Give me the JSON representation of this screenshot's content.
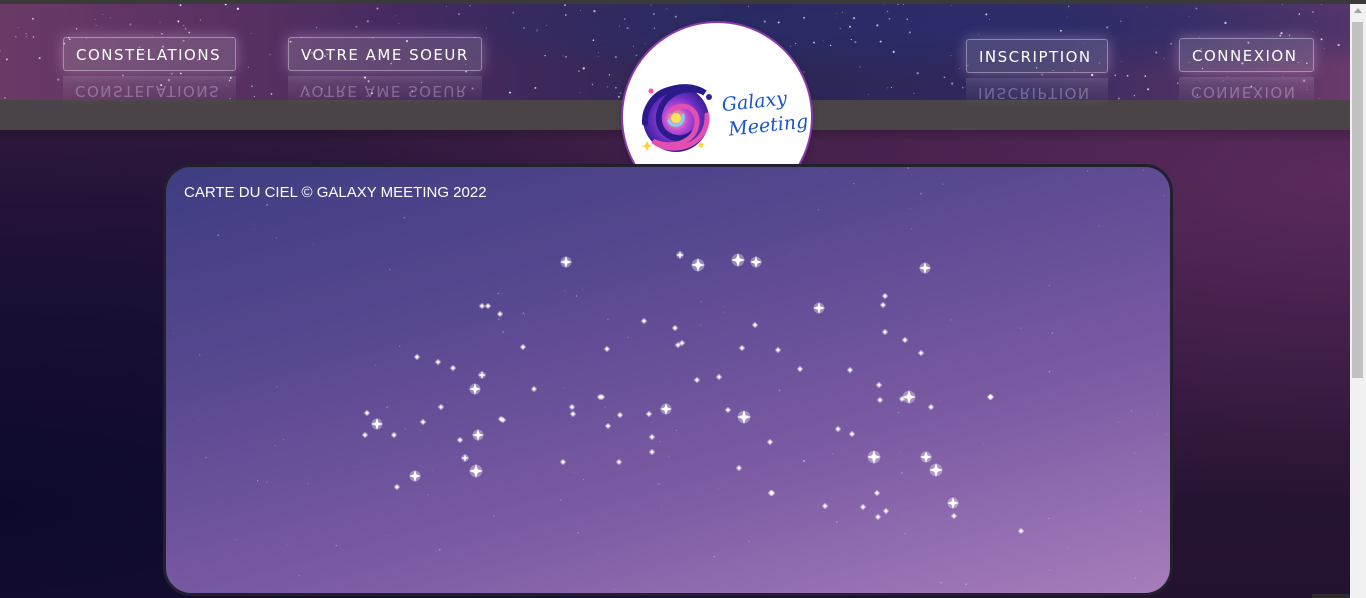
{
  "nav": {
    "constellations": "CONSTELATIONS",
    "soulmate": "VOTRE AME SOEUR",
    "signup": "INSCRIPTION",
    "login": "CONNEXION"
  },
  "logo": {
    "line1": "Galaxy",
    "line2": "Meeting",
    "icon": "galaxy-spiral-icon"
  },
  "sky_map": {
    "caption": "CARTE DU CIEL © GALAXY MEETING 2022"
  },
  "colors": {
    "logo_text": "#1b55c9",
    "logo_ring": "#8a3aa8",
    "sky_top": "#3e3d82",
    "sky_bottom": "#a77dbb"
  }
}
